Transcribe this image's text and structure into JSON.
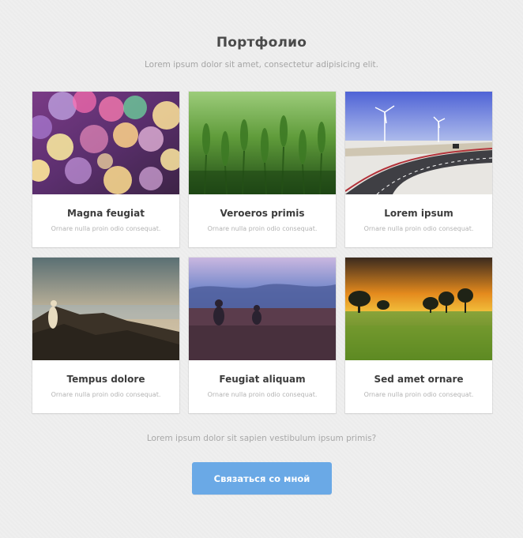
{
  "header": {
    "title": "Портфолио",
    "subtitle": "Lorem ipsum dolor sit amet, consectetur adipisicing elit."
  },
  "portfolio": {
    "items": [
      {
        "title": "Magna feugiat",
        "description": "Ornare nulla proin odio consequat.",
        "image": "bokeh-lights-photo"
      },
      {
        "title": "Veroeros primis",
        "description": "Ornare nulla proin odio consequat.",
        "image": "wheat-field-photo"
      },
      {
        "title": "Lorem ipsum",
        "description": "Ornare nulla proin odio consequat.",
        "image": "wind-turbine-road-photo"
      },
      {
        "title": "Tempus dolore",
        "description": "Ornare nulla proin odio consequat.",
        "image": "rocky-coast-figure-photo"
      },
      {
        "title": "Feugiat aliquam",
        "description": "Ornare nulla proin odio consequat.",
        "image": "misty-field-people-photo"
      },
      {
        "title": "Sed amet ornare",
        "description": "Ornare nulla proin odio consequat.",
        "image": "sunset-meadow-photo"
      }
    ]
  },
  "footer": {
    "text": "Lorem ipsum dolor sit sapien vestibulum ipsum primis?",
    "button_label": "Связаться со мной"
  },
  "colors": {
    "background": "#efefef",
    "card": "#ffffff",
    "button": "#6aa9e6",
    "title": "#4a4a4a"
  }
}
